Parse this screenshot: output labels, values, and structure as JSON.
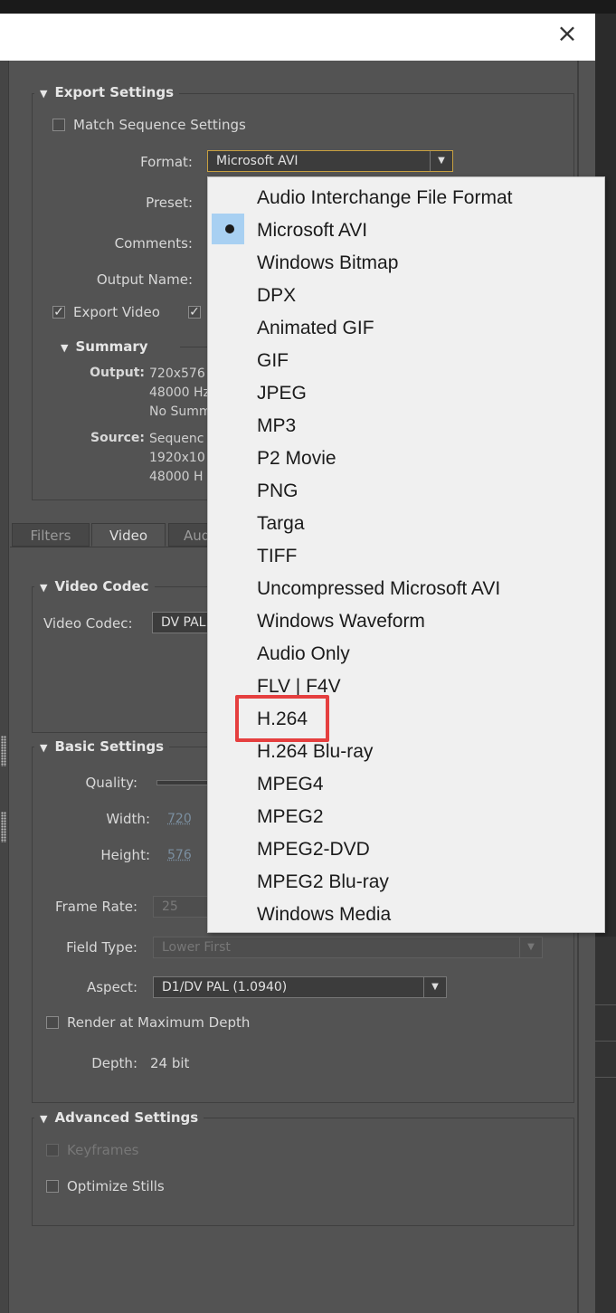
{
  "dialog": {
    "close_label": "×"
  },
  "export_settings": {
    "title": "Export Settings",
    "match_sequence_label": "Match Sequence Settings",
    "format_label": "Format:",
    "format_value": "Microsoft AVI",
    "preset_label": "Preset:",
    "comments_label": "Comments:",
    "output_name_label": "Output Name:",
    "export_video_label": "Export Video",
    "export_video_checked": true,
    "export_audio_checked": true
  },
  "summary": {
    "title": "Summary",
    "output_label": "Output:",
    "output_lines": [
      "720x576",
      "48000 Hz",
      "No Summ"
    ],
    "source_label": "Source:",
    "source_lines": [
      "Sequenc",
      "1920x10",
      "48000 H"
    ]
  },
  "tabs": [
    {
      "label": "Filters",
      "active": false
    },
    {
      "label": "Video",
      "active": true
    },
    {
      "label": "Aud",
      "active": false
    }
  ],
  "video_codec": {
    "title": "Video Codec",
    "codec_label": "Video Codec:",
    "codec_value": "DV PAL"
  },
  "basic_settings": {
    "title": "Basic Settings",
    "quality_label": "Quality:",
    "width_label": "Width:",
    "width_value": "720",
    "height_label": "Height:",
    "height_value": "576",
    "frame_rate_label": "Frame Rate:",
    "frame_rate_value": "25",
    "field_type_label": "Field Type:",
    "field_type_value": "Lower First",
    "aspect_label": "Aspect:",
    "aspect_value": "D1/DV PAL (1.0940)",
    "render_max_depth_label": "Render at Maximum Depth",
    "depth_label": "Depth:",
    "depth_value": "24 bit"
  },
  "advanced_settings": {
    "title": "Advanced Settings",
    "keyframes_label": "Keyframes",
    "optimize_stills_label": "Optimize Stills"
  },
  "format_menu": {
    "selected_index": 1,
    "highlighted_index": 16,
    "items": [
      "Audio Interchange File Format",
      "Microsoft AVI",
      "Windows Bitmap",
      "DPX",
      "Animated GIF",
      "GIF",
      "JPEG",
      "MP3",
      "P2 Movie",
      "PNG",
      "Targa",
      "TIFF",
      "Uncompressed Microsoft AVI",
      "Windows Waveform",
      "Audio Only",
      "FLV | F4V",
      "H.264",
      "H.264 Blu-ray",
      "MPEG4",
      "MPEG2",
      "MPEG2-DVD",
      "MPEG2 Blu-ray",
      "Windows Media"
    ]
  },
  "colors": {
    "highlight_box": "#e53f3f",
    "selected_bg": "#a8d0f2",
    "panel_bg": "#535353"
  }
}
